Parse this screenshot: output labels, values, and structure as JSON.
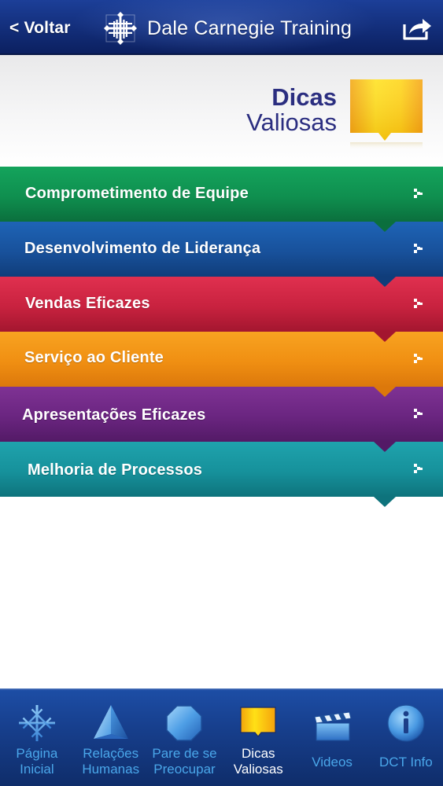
{
  "header": {
    "back_label": "< Voltar",
    "brand_name": "Dale Carnegie Training",
    "brand_logo_icon": "dale-carnegie-logo",
    "share_icon": "share-icon",
    "background_color": "#14307e"
  },
  "hero": {
    "title": "Dicas",
    "subtitle": "Valiosas",
    "icon": "speech-bubble-icon",
    "text_color": "#2b2e80"
  },
  "categories": [
    {
      "label": "Comprometimento de Equipe",
      "color": "#0f8f4f",
      "arrow_icon": "chevron-right-icon"
    },
    {
      "label": "Desenvolvimento de Liderança",
      "color": "#18519b",
      "arrow_icon": "chevron-right-icon"
    },
    {
      "label": "Vendas Eficazes",
      "color": "#c8223f",
      "arrow_icon": "chevron-right-icon"
    },
    {
      "label": "Serviço ao Cliente",
      "color": "#f08f12",
      "arrow_icon": "chevron-right-icon"
    },
    {
      "label": "Apresentações Eficazes",
      "color": "#6a2580",
      "arrow_icon": "chevron-right-icon"
    },
    {
      "label": "Melhoria de Processos",
      "color": "#16919b",
      "arrow_icon": "chevron-right-icon"
    }
  ],
  "tabbar": {
    "active_index": 3,
    "active_color": "#ffffff",
    "inactive_color": "#4aa7ea",
    "tabs": [
      {
        "label": "Página\nInicial",
        "icon": "home-logo-icon"
      },
      {
        "label": "Relações\nHumanas",
        "icon": "pyramid-icon"
      },
      {
        "label": "Pare de se\nPreocupar",
        "icon": "octagon-icon"
      },
      {
        "label": "Dicas\nValiosas",
        "icon": "speech-bubble-icon"
      },
      {
        "label": "Videos",
        "icon": "clapperboard-icon"
      },
      {
        "label": "DCT Info",
        "icon": "info-icon"
      }
    ]
  }
}
